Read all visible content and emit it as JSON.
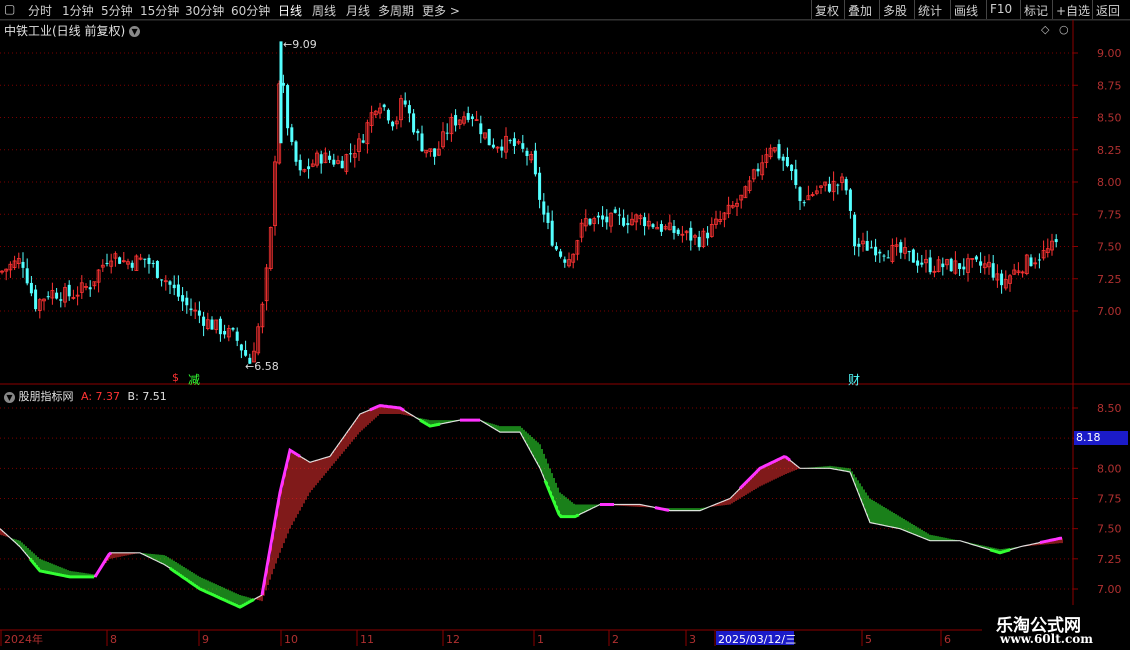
{
  "toolbar": {
    "left_items": [
      "分时",
      "1分钟",
      "5分钟",
      "15分钟",
      "30分钟",
      "60分钟",
      "日线",
      "周线",
      "月线",
      "多周期",
      "更多 >"
    ],
    "active": "日线",
    "right_items": [
      "复权",
      "叠加",
      "多股",
      "统计",
      "画线",
      "F10",
      "标记",
      "+自选",
      "返回"
    ]
  },
  "main_panel": {
    "title": "中铁工业(日线 前复权)",
    "high_label": "9.09",
    "low_label": "6.58",
    "markers": {
      "left_s": "$",
      "left_text": "减",
      "right_text": "财"
    },
    "y_ticks": [
      "9.00",
      "8.75",
      "8.50",
      "8.25",
      "8.00",
      "7.75",
      "7.50",
      "7.25",
      "7.00"
    ]
  },
  "indicator_panel": {
    "name": "股朋指标网",
    "a_label": "A:",
    "a_value": "7.37",
    "b_label": "B:",
    "b_value": "7.51",
    "current_value": "8.18",
    "y_ticks": [
      "8.50",
      "8.25",
      "8.00",
      "7.75",
      "7.50",
      "7.25",
      "7.00"
    ]
  },
  "x_axis": {
    "labels": [
      "2024年",
      "8",
      "9",
      "10",
      "11",
      "12",
      "1",
      "2",
      "3",
      "2025/03/12/三",
      "5",
      "6"
    ]
  },
  "watermark": {
    "line1": "乐淘公式网",
    "line2": "www.60lt.com"
  },
  "colors": {
    "up": "#ff3333",
    "down": "#54ffff",
    "ind_up": "#ff3333",
    "ind_down": "#33ff33",
    "highlight": "#ff33ff",
    "grid": "#8b0000"
  },
  "chart_data": {
    "type": "candlestick",
    "price_axis": [
      7.0,
      9.0
    ],
    "series": [
      {
        "name": "A",
        "values": [
          7.37
        ]
      },
      {
        "name": "B",
        "values": [
          7.51
        ]
      }
    ],
    "close_path": [
      [
        0,
        7.3
      ],
      [
        10,
        7.35
      ],
      [
        22,
        7.4
      ],
      [
        35,
        7.05
      ],
      [
        50,
        7.15
      ],
      [
        70,
        7.12
      ],
      [
        90,
        7.2
      ],
      [
        110,
        7.45
      ],
      [
        125,
        7.38
      ],
      [
        145,
        7.4
      ],
      [
        165,
        7.25
      ],
      [
        185,
        7.05
      ],
      [
        210,
        6.9
      ],
      [
        235,
        6.8
      ],
      [
        250,
        6.6
      ],
      [
        262,
        7.0
      ],
      [
        270,
        7.5
      ],
      [
        280,
        8.9
      ],
      [
        290,
        8.3
      ],
      [
        300,
        8.05
      ],
      [
        320,
        8.2
      ],
      [
        340,
        8.15
      ],
      [
        360,
        8.3
      ],
      [
        378,
        8.65
      ],
      [
        395,
        8.45
      ],
      [
        403,
        8.65
      ],
      [
        420,
        8.3
      ],
      [
        435,
        8.2
      ],
      [
        450,
        8.45
      ],
      [
        470,
        8.55
      ],
      [
        490,
        8.3
      ],
      [
        510,
        8.3
      ],
      [
        530,
        8.2
      ],
      [
        545,
        7.7
      ],
      [
        558,
        7.45
      ],
      [
        568,
        7.4
      ],
      [
        585,
        7.7
      ],
      [
        610,
        7.7
      ],
      [
        640,
        7.72
      ],
      [
        660,
        7.65
      ],
      [
        680,
        7.6
      ],
      [
        700,
        7.55
      ],
      [
        720,
        7.7
      ],
      [
        745,
        7.9
      ],
      [
        770,
        8.3
      ],
      [
        790,
        8.1
      ],
      [
        800,
        7.85
      ],
      [
        820,
        7.95
      ],
      [
        845,
        8.0
      ],
      [
        855,
        7.5
      ],
      [
        870,
        7.5
      ],
      [
        900,
        7.45
      ],
      [
        930,
        7.35
      ],
      [
        960,
        7.35
      ],
      [
        990,
        7.35
      ],
      [
        1000,
        7.2
      ],
      [
        1020,
        7.35
      ],
      [
        1045,
        7.45
      ],
      [
        1058,
        7.52
      ]
    ],
    "indicator_a": [
      [
        0,
        7.5
      ],
      [
        20,
        7.35
      ],
      [
        40,
        7.15
      ],
      [
        70,
        7.1
      ],
      [
        95,
        7.1
      ],
      [
        110,
        7.3
      ],
      [
        140,
        7.3
      ],
      [
        165,
        7.2
      ],
      [
        200,
        7.0
      ],
      [
        240,
        6.85
      ],
      [
        262,
        6.95
      ],
      [
        280,
        7.8
      ],
      [
        290,
        8.15
      ],
      [
        310,
        8.05
      ],
      [
        330,
        8.1
      ],
      [
        360,
        8.45
      ],
      [
        380,
        8.52
      ],
      [
        400,
        8.5
      ],
      [
        430,
        8.35
      ],
      [
        460,
        8.4
      ],
      [
        480,
        8.4
      ],
      [
        500,
        8.3
      ],
      [
        520,
        8.3
      ],
      [
        540,
        8.0
      ],
      [
        560,
        7.6
      ],
      [
        575,
        7.6
      ],
      [
        600,
        7.7
      ],
      [
        640,
        7.7
      ],
      [
        670,
        7.65
      ],
      [
        700,
        7.65
      ],
      [
        730,
        7.75
      ],
      [
        760,
        8.0
      ],
      [
        785,
        8.1
      ],
      [
        800,
        8.0
      ],
      [
        830,
        8.0
      ],
      [
        850,
        7.97
      ],
      [
        870,
        7.55
      ],
      [
        900,
        7.5
      ],
      [
        930,
        7.4
      ],
      [
        960,
        7.4
      ],
      [
        1000,
        7.3
      ],
      [
        1020,
        7.35
      ],
      [
        1060,
        7.42
      ]
    ],
    "indicator_b": [
      [
        0,
        7.45
      ],
      [
        20,
        7.4
      ],
      [
        40,
        7.25
      ],
      [
        70,
        7.15
      ],
      [
        95,
        7.12
      ],
      [
        110,
        7.25
      ],
      [
        140,
        7.3
      ],
      [
        165,
        7.28
      ],
      [
        200,
        7.1
      ],
      [
        240,
        6.95
      ],
      [
        262,
        6.9
      ],
      [
        280,
        7.3
      ],
      [
        290,
        7.5
      ],
      [
        310,
        7.8
      ],
      [
        330,
        8.0
      ],
      [
        360,
        8.3
      ],
      [
        380,
        8.45
      ],
      [
        400,
        8.45
      ],
      [
        430,
        8.4
      ],
      [
        460,
        8.4
      ],
      [
        480,
        8.4
      ],
      [
        500,
        8.35
      ],
      [
        520,
        8.35
      ],
      [
        540,
        8.2
      ],
      [
        560,
        7.8
      ],
      [
        575,
        7.7
      ],
      [
        600,
        7.7
      ],
      [
        640,
        7.68
      ],
      [
        670,
        7.67
      ],
      [
        700,
        7.67
      ],
      [
        730,
        7.7
      ],
      [
        760,
        7.85
      ],
      [
        785,
        7.95
      ],
      [
        800,
        8.0
      ],
      [
        830,
        8.02
      ],
      [
        850,
        8.0
      ],
      [
        870,
        7.75
      ],
      [
        900,
        7.6
      ],
      [
        930,
        7.45
      ],
      [
        960,
        7.4
      ],
      [
        1000,
        7.33
      ],
      [
        1020,
        7.35
      ],
      [
        1060,
        7.38
      ]
    ]
  }
}
